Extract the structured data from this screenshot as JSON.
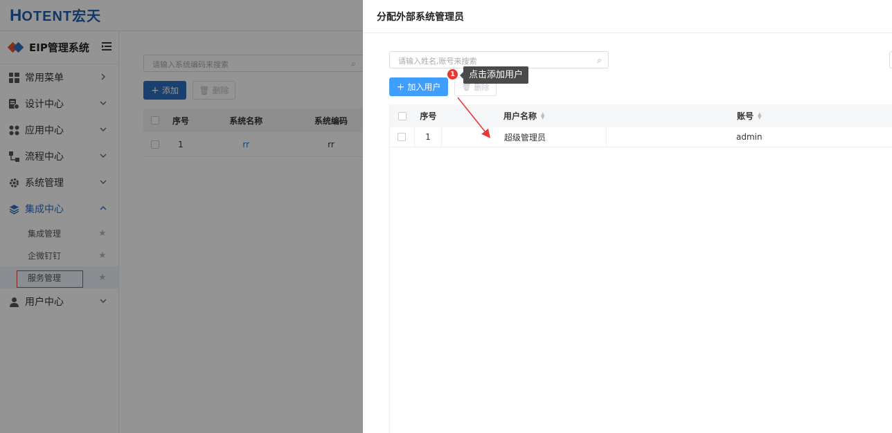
{
  "brand": {
    "logo_mark": "H",
    "logo_text": "OTENT宏天",
    "system_title": "EIP管理系统"
  },
  "sidebar": {
    "items": [
      {
        "label": "常用菜单",
        "icon": "grid-icon"
      },
      {
        "label": "设计中心",
        "icon": "design-icon"
      },
      {
        "label": "应用中心",
        "icon": "apps-icon"
      },
      {
        "label": "流程中心",
        "icon": "flow-icon"
      },
      {
        "label": "系统管理",
        "icon": "gear-icon"
      },
      {
        "label": "集成中心",
        "icon": "layers-icon"
      },
      {
        "label": "用户中心",
        "icon": "user-icon"
      }
    ],
    "sub_items": [
      {
        "label": "集成管理"
      },
      {
        "label": "企微钉钉"
      },
      {
        "label": "服务管理"
      }
    ]
  },
  "background": {
    "search_placeholder": "请输入系统编码来搜索",
    "add_label": "添加",
    "delete_label": "删除",
    "columns": [
      "序号",
      "系统名称",
      "系统编码"
    ],
    "rows": [
      {
        "index": "1",
        "name": "rr",
        "code": "rr"
      }
    ]
  },
  "drawer": {
    "title": "分配外部系统管理员",
    "search_placeholder": "请输入姓名,账号来搜索",
    "add_label": "加入用户",
    "delete_label": "删除",
    "tooltip": "点击添加用户",
    "badge": "1",
    "columns": {
      "index": "序号",
      "name": "用户名称",
      "account": "账号"
    },
    "rows": [
      {
        "index": "1",
        "name": "超级管理员",
        "account": "admin"
      }
    ]
  },
  "colors": {
    "primary": "#409eff",
    "brand": "#2d6fc0",
    "annotation": "#e53935"
  }
}
